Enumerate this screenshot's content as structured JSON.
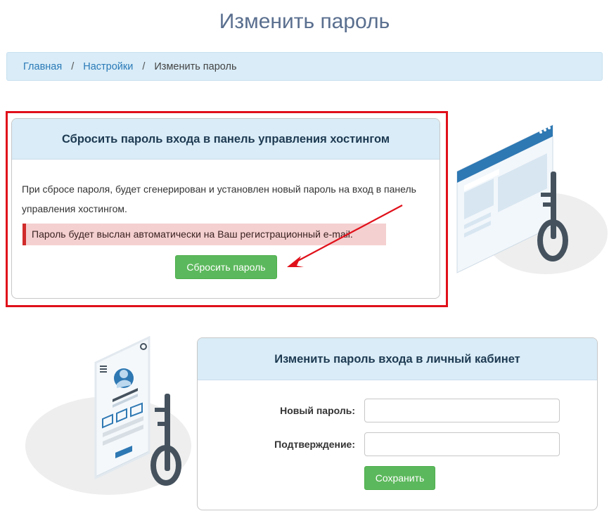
{
  "page": {
    "title": "Изменить пароль"
  },
  "breadcrumb": {
    "items": [
      {
        "label": "Главная"
      },
      {
        "label": "Настройки"
      }
    ],
    "separator": "/",
    "current": "Изменить пароль"
  },
  "reset_card": {
    "title": "Сбросить пароль входа в панель управления хостингом",
    "description": "При сбросе пароля, будет сгенерирован и установлен новый пароль на вход в панель управления хостингом.",
    "alert": "Пароль будет выслан автоматически на Ваш регистрационный e-mail.",
    "button_label": "Сбросить пароль"
  },
  "change_card": {
    "title": "Изменить пароль входа в личный кабинет",
    "new_password_label": "Новый пароль:",
    "new_password_value": "",
    "confirm_label": "Подтверждение:",
    "confirm_value": "",
    "button_label": "Сохранить"
  },
  "colors": {
    "highlight_frame": "#e0101a",
    "button_green": "#5cb85c",
    "header_bg": "#d9ecf7",
    "link": "#2a7ab8",
    "alert_bg": "#f5d0d0",
    "alert_border": "#d12b2b"
  },
  "icons": {
    "browser_illustration": "browser-key-illustration",
    "phone_illustration": "phone-key-illustration",
    "arrow": "red-arrow-icon"
  }
}
